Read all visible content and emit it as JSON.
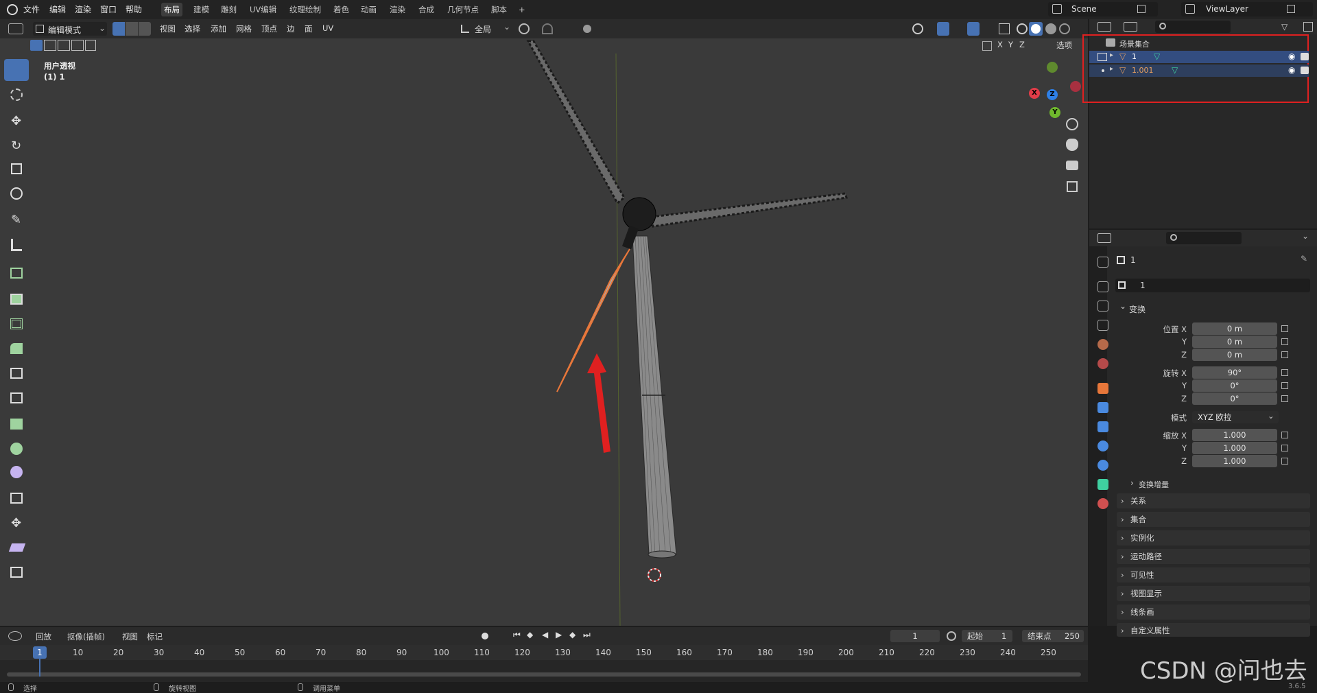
{
  "topbar": {
    "menus": [
      "文件",
      "编辑",
      "渲染",
      "窗口",
      "帮助"
    ],
    "workspaces": [
      "布局",
      "建模",
      "雕刻",
      "UV编辑",
      "纹理绘制",
      "着色",
      "动画",
      "渲染",
      "合成",
      "几何节点",
      "脚本"
    ],
    "active_workspace": "布局",
    "add_tab": "+",
    "scene": "Scene",
    "view_layer": "ViewLayer"
  },
  "viewport_header": {
    "mode": "编辑模式",
    "menus": [
      "视图",
      "选择",
      "添加",
      "网格",
      "顶点",
      "边",
      "面",
      "UV"
    ],
    "transform_orientation": "全局",
    "axes": [
      "X",
      "Y",
      "Z"
    ],
    "options": "选项"
  },
  "viewport": {
    "view_name": "用户透视",
    "object_label": "(1) 1",
    "gizmo": {
      "x": "X",
      "y": "Y",
      "z": "Z"
    }
  },
  "outliner": {
    "collection": "场景集合",
    "items": [
      {
        "name": "1",
        "selected": true
      },
      {
        "name": "1.001",
        "selected": false
      }
    ]
  },
  "properties": {
    "object_name": "1",
    "datablock_name": "1",
    "transform_header": "变换",
    "location": {
      "label_x": "位置 X",
      "label_y": "Y",
      "label_z": "Z",
      "x": "0 m",
      "y": "0 m",
      "z": "0 m"
    },
    "rotation": {
      "label_x": "旋转 X",
      "label_y": "Y",
      "label_z": "Z",
      "x": "90°",
      "y": "0°",
      "z": "0°"
    },
    "mode_label": "模式",
    "mode_value": "XYZ 欧拉",
    "scale": {
      "label_x": "缩放 X",
      "label_y": "Y",
      "label_z": "Z",
      "x": "1.000",
      "y": "1.000",
      "z": "1.000"
    },
    "delta_transform": "变换增量",
    "panels": [
      "关系",
      "集合",
      "实例化",
      "运动路径",
      "可见性",
      "视图显示",
      "线条画",
      "自定义属性"
    ]
  },
  "timeline": {
    "menus": [
      "回放",
      "抠像(插帧)",
      "视图",
      "标记"
    ],
    "current_frame": "1",
    "start_label": "起始",
    "start": "1",
    "end_label": "结束点",
    "end": "250",
    "ticks": [
      "1",
      "10",
      "20",
      "30",
      "40",
      "50",
      "60",
      "70",
      "80",
      "90",
      "100",
      "110",
      "120",
      "130",
      "140",
      "150",
      "160",
      "170",
      "180",
      "190",
      "200",
      "210",
      "220",
      "230",
      "240",
      "250"
    ]
  },
  "status": {
    "select": "选择",
    "rotate": "旋转视图",
    "menu": "调用菜单",
    "version": "3.6.5"
  },
  "watermark": "CSDN @问也去",
  "colors": {
    "accent": "#4772b3",
    "selected_edge": "#e8773a",
    "annotation_arrow": "#e02020",
    "highlight_box": "#e02020"
  }
}
